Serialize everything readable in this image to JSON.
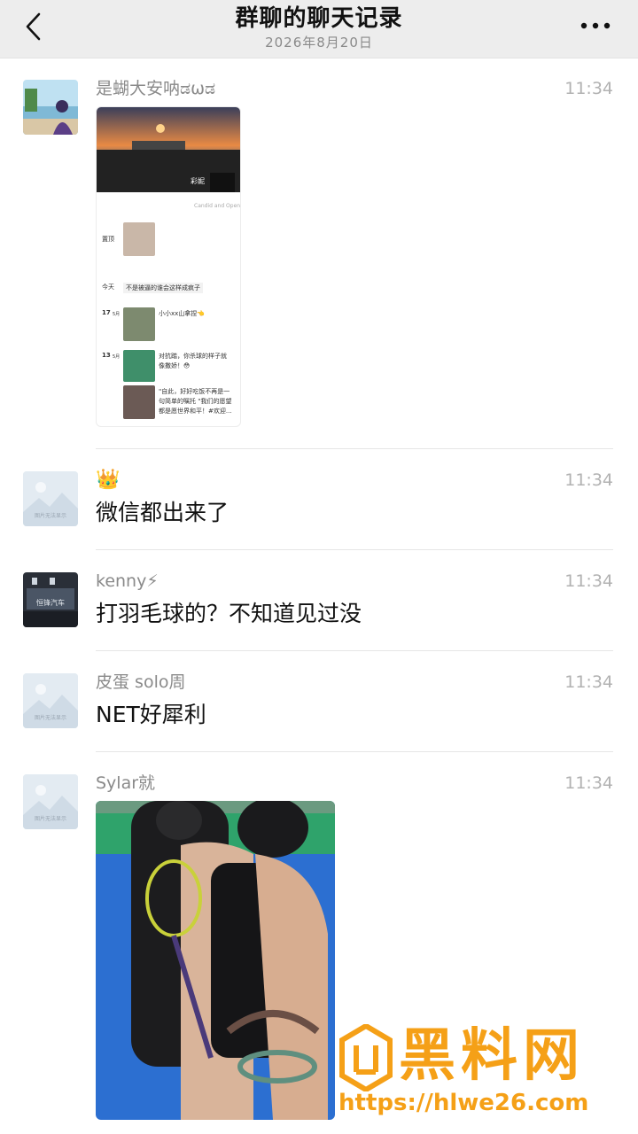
{
  "header": {
    "title": "群聊的聊天记录",
    "date": "2026年8月20日"
  },
  "messages": [
    {
      "sender": "是蝴大安呐ಡωಡ",
      "time": "11:34",
      "screenshot": {
        "name_tag": "彩妮",
        "caption": "Candid and Open",
        "pinned_label": "置顶",
        "today_label": "今天",
        "today_text": "不是被逼的谁会这样成疯子",
        "day1_label": "17",
        "day1_unit": "5月",
        "day1_text": "小小xx山拿捏👈",
        "day2_label": "13",
        "day2_unit": "5月",
        "day2_text1": "对抗踏，你杀球的样子就",
        "day2_text2": "像撒娇！😳",
        "day2_text3": "\"自此，好好吃饭不再是一",
        "day2_text4": "句简单的嘱托 \"我们的愿望",
        "day2_text5": "都是愿世界和平！#欢迎..."
      }
    },
    {
      "sender": "👑",
      "time": "11:34",
      "text": "微信都出来了",
      "avatar_caption": "图片无法显示"
    },
    {
      "sender": "kenny⚡",
      "time": "11:34",
      "text": "打羽毛球的？不知道见过没",
      "avatar_caption": "恒锋汽车"
    },
    {
      "sender": "皮蛋 solo周",
      "time": "11:34",
      "text": "NET好犀利",
      "avatar_caption": "图片无法显示"
    },
    {
      "sender": "Sylar就",
      "time": "11:34",
      "avatar_caption": "图片无法显示"
    }
  ],
  "watermark": {
    "brand": "黑料网",
    "url": "https://hlwe26.com"
  },
  "colors": {
    "header_bg": "#ededed",
    "time_gray": "#b2b2b2",
    "sender_gray": "#8a8a8a",
    "watermark_orange": "#f5a017",
    "court_green": "#2fa36b",
    "court_blue": "#2c6fd1"
  }
}
